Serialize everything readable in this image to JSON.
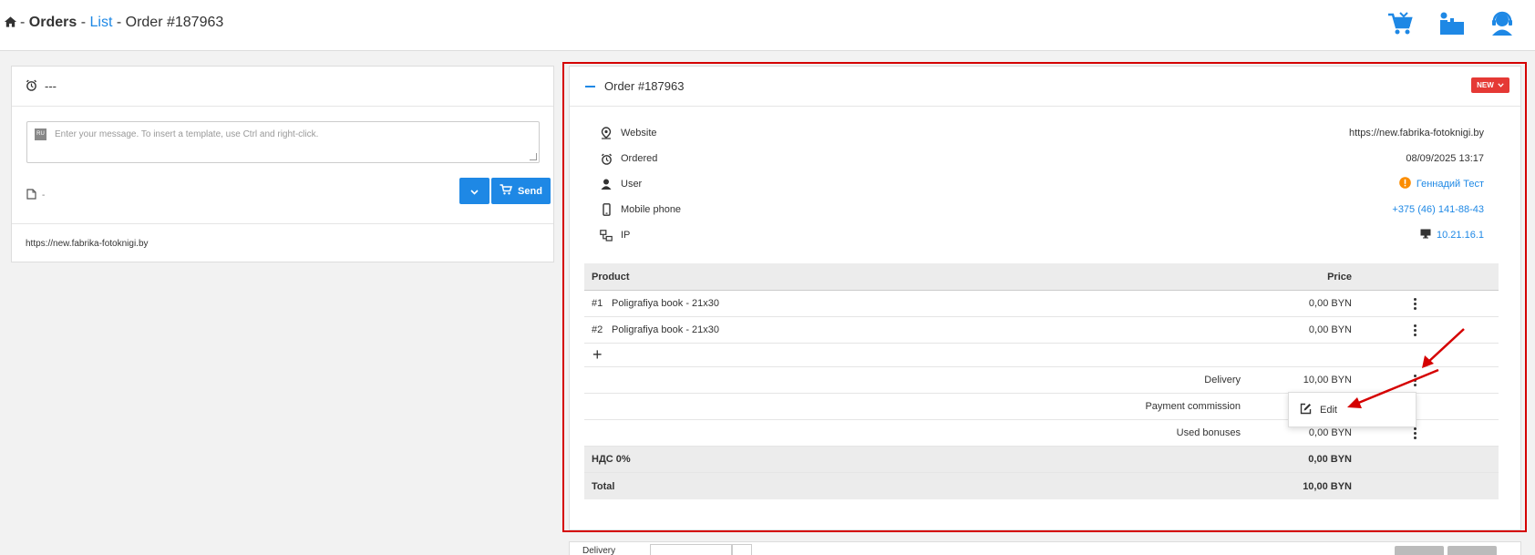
{
  "breadcrumb": {
    "sep": "-",
    "orders": "Orders",
    "list": "List",
    "current": "Order #187963"
  },
  "colors": {
    "accent": "#1e88e5",
    "status_new": "#e53935",
    "highlight_frame": "#d50000"
  },
  "header_icons": [
    "cart-icon",
    "office-user-icon",
    "support-agent-icon"
  ],
  "left_panel": {
    "head_text": "---",
    "message_placeholder": "Enter your message. To insert a template, use Ctrl and right-click.",
    "lang_badge": "RU",
    "attachment_text": "-",
    "send_label": "Send",
    "footer_url": "https://new.fabrika-fotoknigi.by"
  },
  "order": {
    "title": "Order #187963",
    "status": "NEW",
    "info": [
      {
        "label": "Website",
        "value": "https://new.fabrika-fotoknigi.by",
        "icon": "map-pin-icon"
      },
      {
        "label": "Ordered",
        "value": "08/09/2025 13:17",
        "icon": "alarm-clock-icon"
      },
      {
        "label": "User",
        "value": "Геннадий Тест",
        "icon": "user-icon"
      },
      {
        "label": "Mobile phone",
        "value": "+375 (46) 141-88-43",
        "icon": "mobile-phone-icon"
      },
      {
        "label": "IP",
        "value": "10.21.16.1",
        "icon": "network-icon"
      }
    ],
    "table": {
      "col_product": "Product",
      "col_price": "Price",
      "items": [
        {
          "num": "#1",
          "name": "Poligrafiya book - 21x30",
          "price": "0,00 BYN"
        },
        {
          "num": "#2",
          "name": "Poligrafiya book - 21x30",
          "price": "0,00 BYN"
        }
      ],
      "add_symbol": "+",
      "extras": [
        {
          "label": "Delivery",
          "price": "10,00 BYN"
        },
        {
          "label": "Payment commission",
          "price": ""
        },
        {
          "label": "Used bonuses",
          "price": "0,00 BYN"
        }
      ],
      "vat_label": "НДС 0%",
      "vat_value": "0,00 BYN",
      "total_label": "Total",
      "total_value": "10,00 BYN"
    },
    "context_menu": {
      "edit": "Edit"
    }
  },
  "bottom": {
    "delivery_label": "Delivery"
  }
}
